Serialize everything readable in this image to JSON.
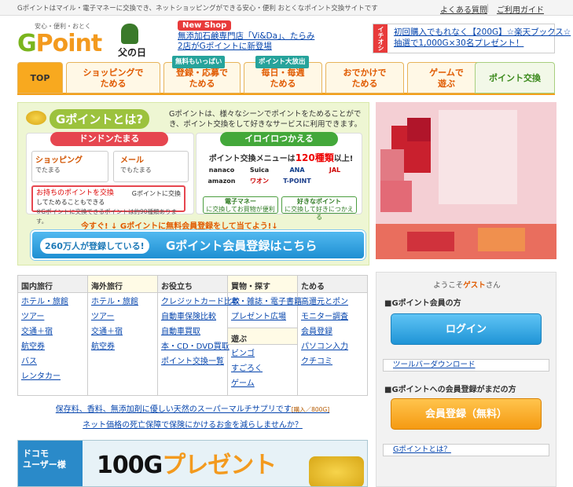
{
  "topbar": {
    "tagline": "Gポイントはマイル・電子マネーに交換でき、ネットショッピングができる安心・便利 おとくなポイント交換サイトです",
    "faq": "よくある質問",
    "guide": "ご利用ガイド"
  },
  "logo": {
    "sub": "安心・便利・おとく",
    "g": "G",
    "point": "Point",
    "fathers_day": "父の日"
  },
  "newshop": {
    "label": "New Shop",
    "line1": "無添加石鹸専門店「Vi&Da」、たらみ",
    "line2": "2店がGポイントに新登場"
  },
  "promo_box": {
    "side": "イチオシ",
    "line1": "初回購入でもれなく【200G】☆楽天ブックス☆",
    "line2": "抽選で1,000G×30名プレゼント！"
  },
  "nav": {
    "tabs": [
      {
        "l1": "TOP",
        "l2": ""
      },
      {
        "l1": "ショッピングで",
        "l2": "ためる"
      },
      {
        "l1": "登録・応募で",
        "l2": "ためる"
      },
      {
        "l1": "毎日・毎週",
        "l2": "ためる"
      },
      {
        "l1": "おでかけで",
        "l2": "ためる"
      },
      {
        "l1": "ゲームで",
        "l2": "遊ぶ"
      },
      {
        "l1": "ポイント交換",
        "l2": ""
      }
    ],
    "badge1": "無料もいっぱい",
    "badge2": "ポイント大放出"
  },
  "hero": {
    "title": "Gポイントとは?",
    "desc": "Gポイントは、様々なシーンでポイントをためることができ、ポイント交換をして好きなサービスに利用できます。",
    "left_header": "ドンドンたまる",
    "shopping": "ショッピング",
    "shopping_sub": "でたまる",
    "mail": "メール",
    "mail_sub": "でもたまる",
    "exchange_line1": "お持ちのポイントを交換",
    "exchange_line2": "してためることもできる",
    "exchange_right": "Gポイントに交換",
    "exchange_note": "※Gポイントに交換できるポイントは約90種類あります。",
    "right_header": "イロイロつかえる",
    "menu_prefix": "ポイント交換メニューは",
    "menu_count": "120種類",
    "menu_suffix": "以上!",
    "logos": [
      "nanaco",
      "Suica",
      "ANA",
      "JAL",
      "amazon",
      "ワオン",
      "T-POINT"
    ],
    "emoney1": "電子マネー",
    "emoney2": "に交換してお買物が便利",
    "fav1": "好きなポイント",
    "fav2": "に交換して好きにつかえる",
    "cta_line": "今すぐ! ↓ Gポイントに無料会員登録をして当てよう!↓",
    "cta_pill": "260万人が登録している!",
    "cta_text": "Gポイント会員登録はこちら"
  },
  "categories": [
    {
      "header": "国内旅行",
      "items": [
        "ホテル・旅館",
        "ツアー",
        "交通＋宿",
        "航空券",
        "バス",
        "レンタカー"
      ]
    },
    {
      "header": "海外旅行",
      "items": [
        "ホテル・旅館",
        "ツアー",
        "交通＋宿",
        "航空券"
      ]
    },
    {
      "header": "お役立ち",
      "items": [
        "クレジットカード比較",
        "自動車保険比較",
        "自動車買取",
        "本・CD・DVD買取",
        "ポイント交換一覧"
      ]
    },
    {
      "header": "買物・探す",
      "items": [
        "本・雑誌・電子書籍",
        "プレゼント広場"
      ],
      "header2": "遊ぶ",
      "items2": [
        "ビンゴ",
        "すごろく",
        "ゲーム"
      ]
    },
    {
      "header": "ためる",
      "items": [
        "高還元とポン",
        "モニター調査",
        "会員登録",
        "パソコン入力",
        "クチコミ"
      ]
    }
  ],
  "promo1": "保存料、香料、無添加剤に優しい天然のスーパーマルチサプリです",
  "promo1_small": "[購入／800G]",
  "promo2": "ネット価格の死亡保障で保険にかけるお金を減らしませんか？",
  "banner": {
    "side_1": "ドコモ",
    "side_2": "ユーザー様",
    "big_num": "100G",
    "big_text": "プレゼント"
  },
  "login": {
    "welcome_prefix": "ようこそ",
    "welcome_guest": "ゲスト",
    "welcome_suffix": "さん",
    "member_section": "■Gポイント会員の方",
    "login_button": "ログイン",
    "toolbar_link": "ツールバーダウンロード",
    "nonmember_section": "■Gポイントへの会員登録がまだの方",
    "register_button": "会員登録（無料）",
    "about_link": "Gポイントとは？"
  },
  "colors": {
    "brand_orange": "#f39a1e",
    "brand_green": "#7ab51d",
    "link": "#0645ad",
    "nav_accent": "#f8a91f"
  }
}
